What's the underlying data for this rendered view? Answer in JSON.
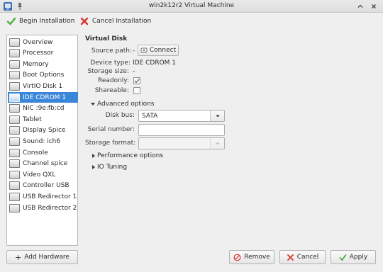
{
  "window": {
    "title": "win2k12r2 Virtual Machine",
    "app_icon": "pin-icon",
    "controls": [
      "chevron-up-icon",
      "close-icon"
    ]
  },
  "toolbar": {
    "begin_label": "Begin Installation",
    "cancel_label": "Cancel Installation"
  },
  "sidebar": {
    "items": [
      {
        "label": "Overview",
        "icon": "overview-icon"
      },
      {
        "label": "Processor",
        "icon": "cpu-icon"
      },
      {
        "label": "Memory",
        "icon": "memory-icon"
      },
      {
        "label": "Boot Options",
        "icon": "boot-icon"
      },
      {
        "label": "VirtIO Disk 1",
        "icon": "disk-icon"
      },
      {
        "label": "IDE CDROM 1",
        "icon": "cdrom-icon",
        "selected": true
      },
      {
        "label": "NIC :9e:fb:cd",
        "icon": "nic-icon"
      },
      {
        "label": "Tablet",
        "icon": "tablet-icon"
      },
      {
        "label": "Display Spice",
        "icon": "display-icon"
      },
      {
        "label": "Sound: ich6",
        "icon": "sound-icon"
      },
      {
        "label": "Console",
        "icon": "console-icon"
      },
      {
        "label": "Channel spice",
        "icon": "channel-icon"
      },
      {
        "label": "Video QXL",
        "icon": "video-icon"
      },
      {
        "label": "Controller USB",
        "icon": "controller-icon"
      },
      {
        "label": "USB Redirector 1",
        "icon": "usb-icon"
      },
      {
        "label": "USB Redirector 2",
        "icon": "usb-icon"
      }
    ],
    "add_hardware_label": "Add Hardware"
  },
  "main": {
    "section_title": "Virtual Disk",
    "source_path_label": "Source path:",
    "source_path_value": "-",
    "connect_label": "Connect",
    "device_type_label": "Device type:",
    "device_type_value": "IDE CDROM 1",
    "storage_size_label": "Storage size:",
    "storage_size_value": "-",
    "readonly_label": "Readonly:",
    "readonly_checked": true,
    "shareable_label": "Shareable:",
    "shareable_checked": false,
    "advanced_label": "Advanced options",
    "disk_bus_label": "Disk bus:",
    "disk_bus_value": "SATA",
    "serial_label": "Serial number:",
    "serial_value": "",
    "storage_format_label": "Storage format:",
    "storage_format_value": "",
    "performance_label": "Performance options",
    "io_tuning_label": "IO Tuning"
  },
  "buttons": {
    "remove": "Remove",
    "cancel": "Cancel",
    "apply": "Apply"
  },
  "colors": {
    "selection": "#3a87d9",
    "accept_green": "#4caf3f",
    "cancel_red": "#d9332b"
  }
}
